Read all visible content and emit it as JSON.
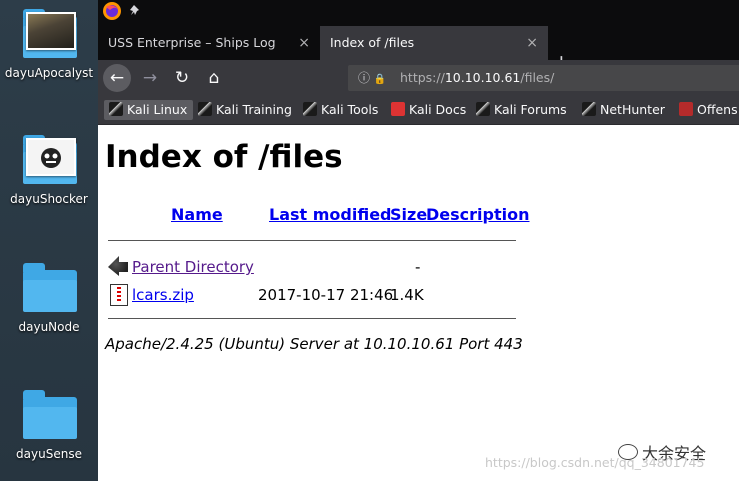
{
  "desktop": {
    "items": [
      {
        "label": "dayuApocalyst",
        "icon": "image-folder-icon"
      },
      {
        "label": "dayuShocker",
        "icon": "image-folder-icon"
      },
      {
        "label": "dayuNode",
        "icon": "folder-icon"
      },
      {
        "label": "dayuSense",
        "icon": "folder-icon"
      }
    ]
  },
  "browser": {
    "tabs": [
      {
        "label": "USS Enterprise – Ships Log",
        "close": "×",
        "active": false
      },
      {
        "label": "Index of /files",
        "close": "×",
        "active": true
      }
    ],
    "new_tab": "+",
    "nav": {
      "back": "←",
      "forward": "→",
      "reload": "↻",
      "home": "⌂"
    },
    "url": {
      "prefix": "https://",
      "host": "10.10.10.61",
      "path": "/files/",
      "info_icon": "ⓘ",
      "lock_icon": "🔒"
    },
    "bookmarks": [
      {
        "label": "Kali Linux",
        "active": true
      },
      {
        "label": "Kali Training"
      },
      {
        "label": "Kali Tools"
      },
      {
        "label": "Kali Docs"
      },
      {
        "label": "Kali Forums"
      },
      {
        "label": "NetHunter"
      },
      {
        "label": "Offens"
      }
    ]
  },
  "page": {
    "title": "Index of /files",
    "columns": {
      "name": "Name",
      "modified": "Last modified",
      "size": "Size",
      "description": "Description"
    },
    "rows": [
      {
        "name": "Parent Directory",
        "modified": "",
        "size": "-",
        "description": ""
      },
      {
        "name": "lcars.zip",
        "modified": "2017-10-17 21:46",
        "size": "1.4K",
        "description": ""
      }
    ],
    "address": "Apache/2.4.25 (Ubuntu) Server at 10.10.10.61 Port 443"
  },
  "watermark": {
    "brand": "大余安全",
    "url": "https://blog.csdn.net/qq_34801745"
  }
}
